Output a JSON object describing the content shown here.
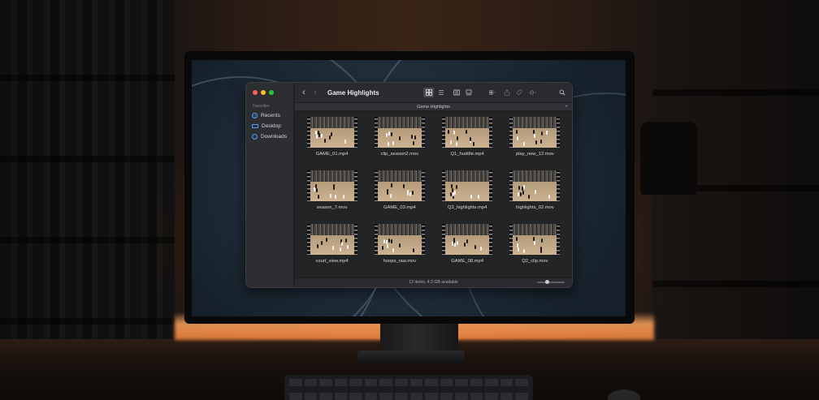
{
  "window": {
    "title": "Game Highlights",
    "path_title": "Game Highlights",
    "status": "12 items, 4.3 GB available"
  },
  "sidebar": {
    "heading": "Favorites",
    "items": [
      {
        "label": "Recents",
        "icon": "clock-icon"
      },
      {
        "label": "Desktop",
        "icon": "desktop-icon"
      },
      {
        "label": "Downloads",
        "icon": "downloads-icon"
      }
    ]
  },
  "files": [
    {
      "name": "GAME_01.mp4"
    },
    {
      "name": "clip_season2.mov"
    },
    {
      "name": "Q1_huddle.mp4"
    },
    {
      "name": "play_new_12.mov"
    },
    {
      "name": "season_7.mov"
    },
    {
      "name": "GAME_03.mp4"
    },
    {
      "name": "Q3_highlights.mp4"
    },
    {
      "name": "highlights_02.mov"
    },
    {
      "name": "court_view.mp4"
    },
    {
      "name": "hoops_raw.mov"
    },
    {
      "name": "GAME_08.mp4"
    },
    {
      "name": "Q2_clip.mov"
    }
  ],
  "zoom_level": 0.35,
  "colors": {
    "accent": "#4ea1ff",
    "close": "#ff5f57",
    "minimize": "#febc2e",
    "maximize": "#28c840"
  }
}
